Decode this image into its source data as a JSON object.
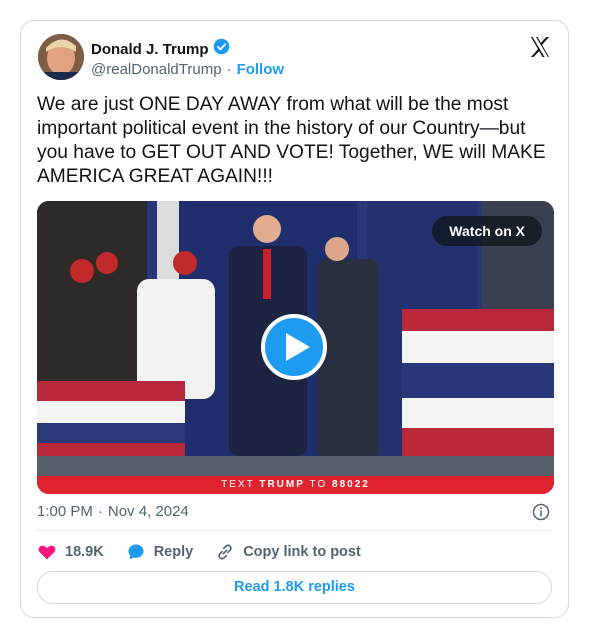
{
  "author": {
    "name": "Donald J. Trump",
    "handle": "@realDonaldTrump",
    "separator": "·",
    "follow_label": "Follow"
  },
  "post": {
    "text": "We are just ONE DAY AWAY from what will be the most important political event in the history of our Country—but you have to GET OUT AND VOTE! Together, WE will MAKE AMERICA GREAT AGAIN!!!"
  },
  "media": {
    "watch_label": "Watch on X",
    "banner_prefix": "TEXT",
    "banner_keyword": "TRUMP",
    "banner_mid": "TO",
    "banner_number": "88022"
  },
  "meta": {
    "time": "1:00 PM",
    "separator": "·",
    "date": "Nov 4, 2024"
  },
  "actions": {
    "likes": "18.9K",
    "reply_label": "Reply",
    "copy_label": "Copy link to post"
  },
  "replies_button": "Read 1.8K replies",
  "colors": {
    "accent": "#1d9bf0",
    "like": "#f91880",
    "banner": "#e0242f",
    "secondary_text": "#536471"
  }
}
